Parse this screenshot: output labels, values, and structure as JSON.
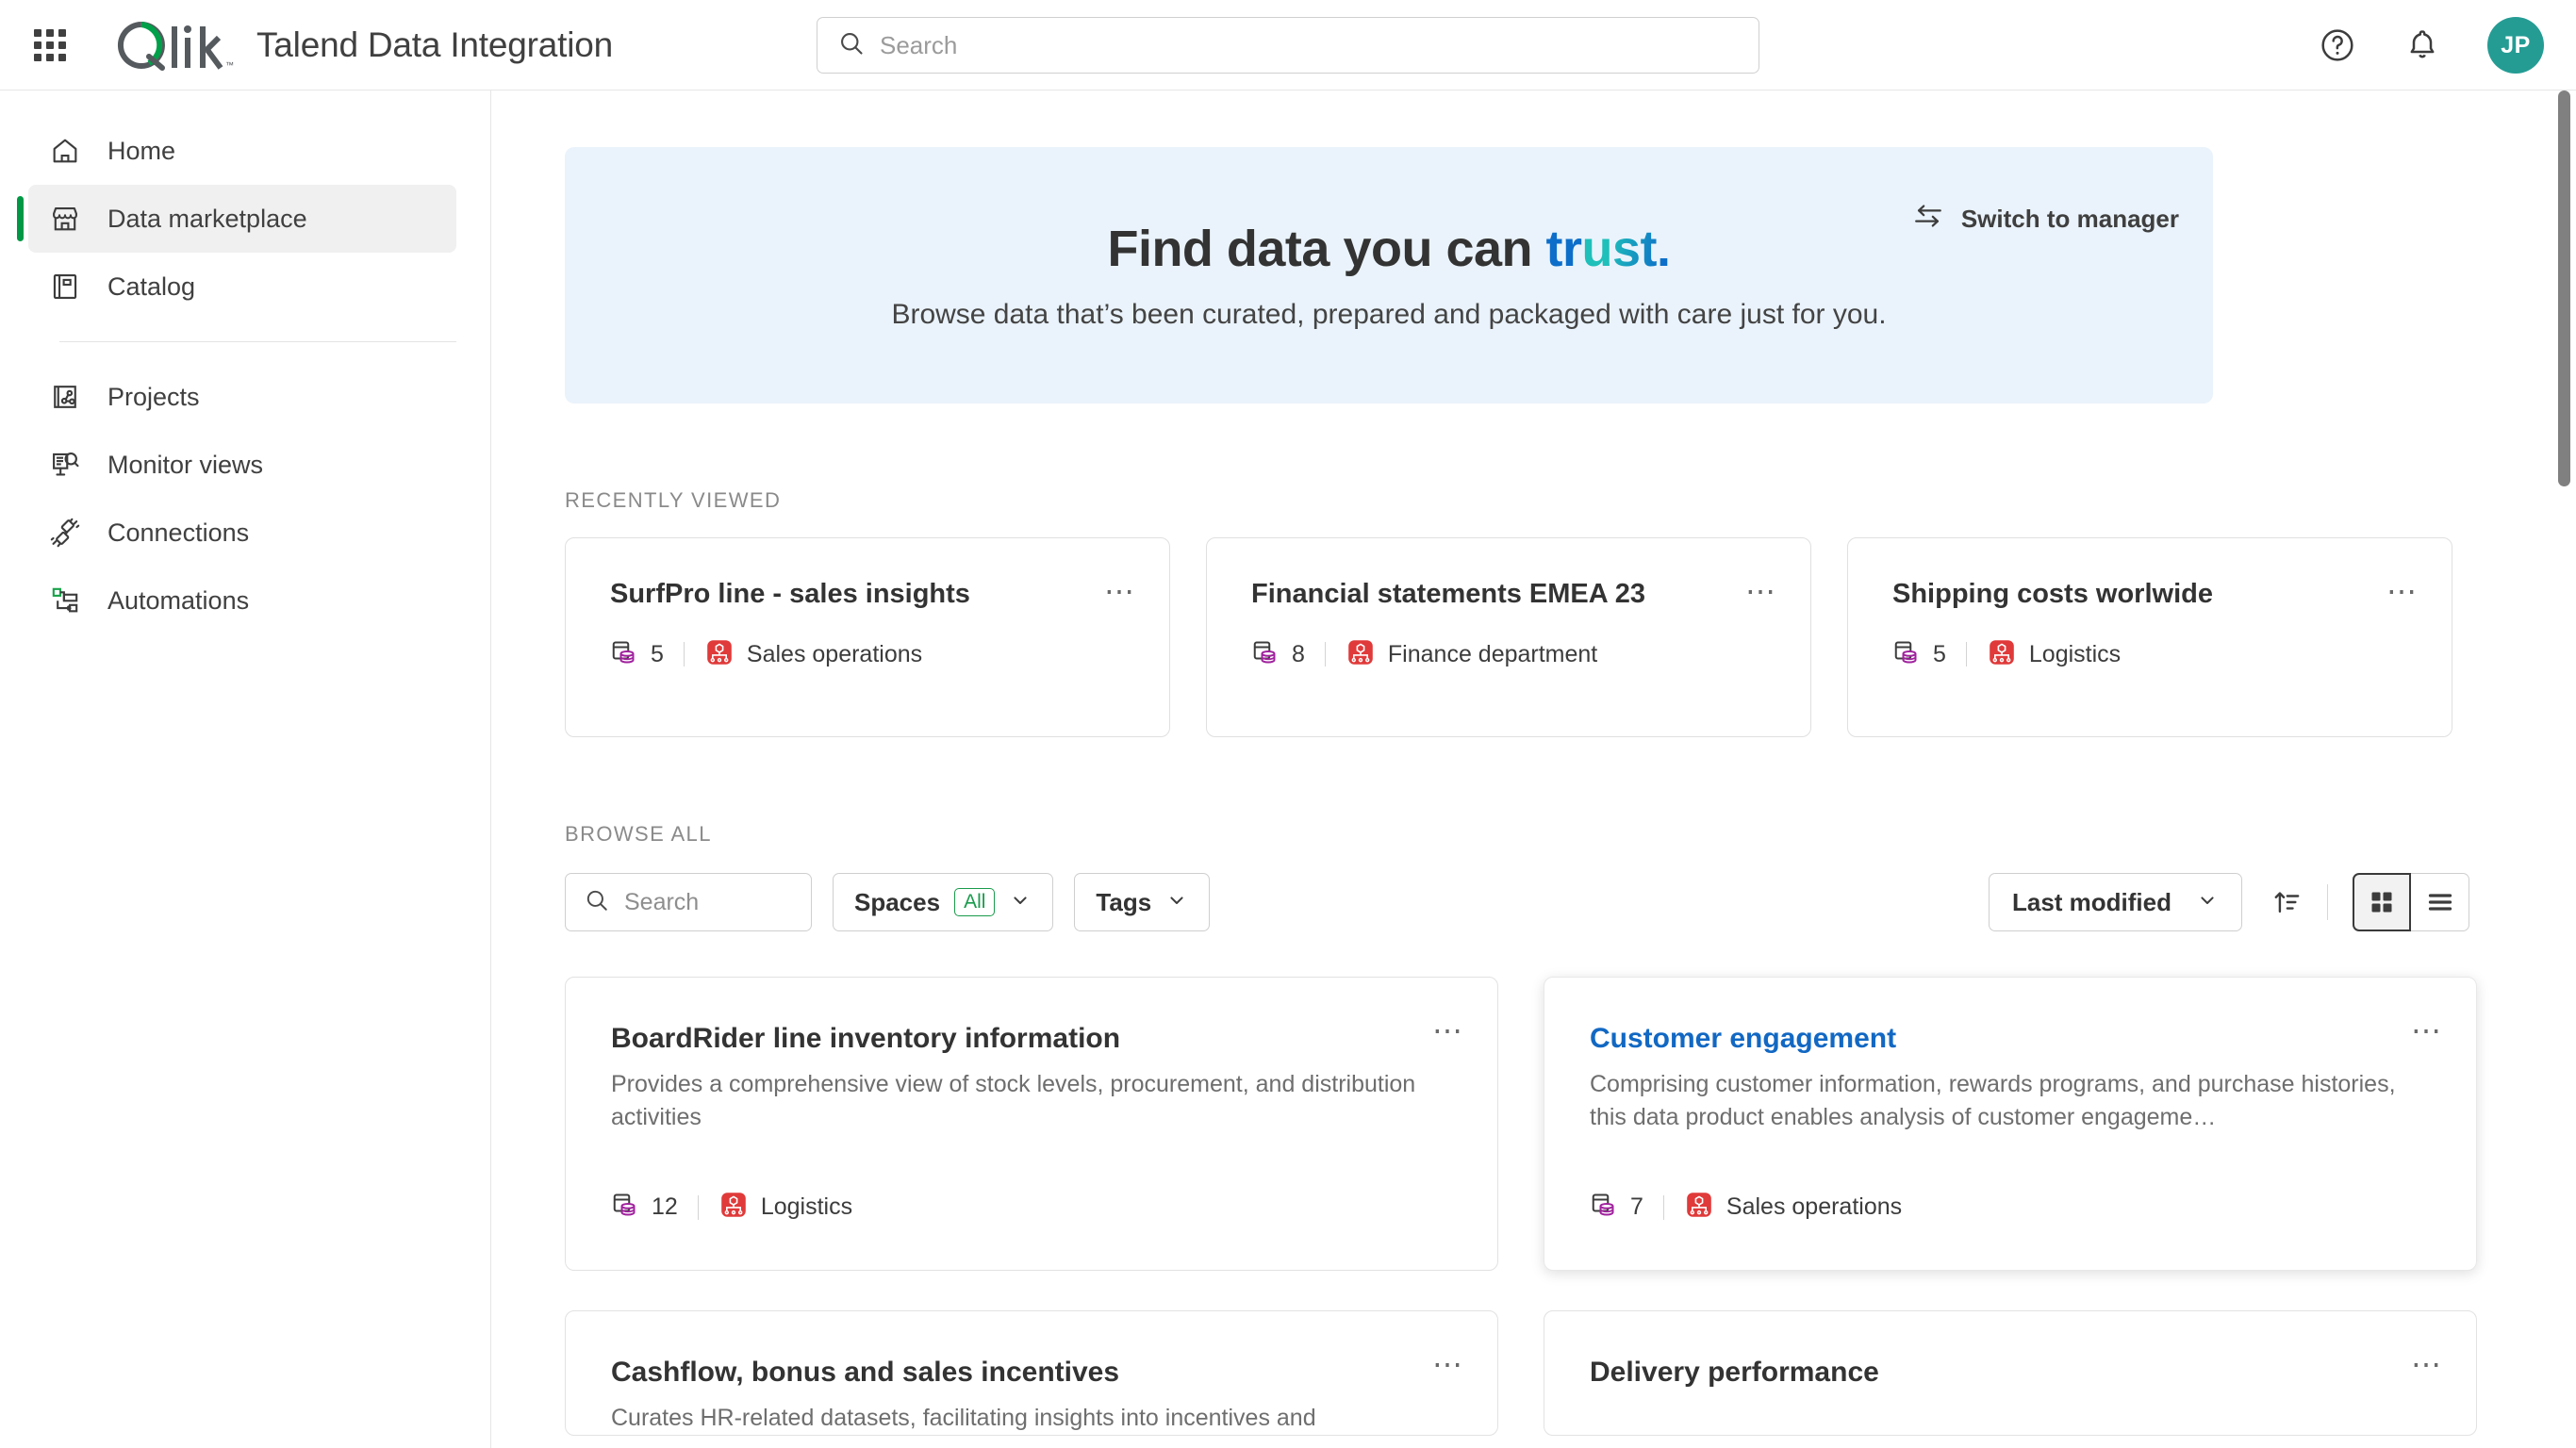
{
  "topbar": {
    "app_launcher_icon": "grid-apps-icon",
    "logo_text": "Qlik",
    "product_title": "Talend Data Integration",
    "search": {
      "placeholder": "Search",
      "value": "",
      "icon": "search-icon"
    },
    "help_icon": "help-circle-icon",
    "notifications_icon": "bell-icon",
    "avatar_initials": "JP",
    "avatar_color": "#249c94"
  },
  "sidebar": {
    "items": [
      {
        "label": "Home",
        "icon": "home-icon",
        "active": false
      },
      {
        "label": "Data marketplace",
        "icon": "marketplace-icon",
        "active": true
      },
      {
        "label": "Catalog",
        "icon": "catalog-icon",
        "active": false
      },
      {
        "label": "Projects",
        "icon": "projects-icon",
        "active": false
      },
      {
        "label": "Monitor views",
        "icon": "monitor-views-icon",
        "active": false
      },
      {
        "label": "Connections",
        "icon": "connections-icon",
        "active": false
      },
      {
        "label": "Automations",
        "icon": "automations-icon",
        "active": false
      }
    ],
    "active_accent_color": "#009845"
  },
  "hero": {
    "title_plain": "Find data you can ",
    "title_accent_1": "tr",
    "title_accent_2": "u",
    "title_accent_3": "st.",
    "subtitle": "Browse data that’s been curated, prepared and packaged with care just for you.",
    "switch_button_label": "Switch to manager",
    "switch_button_icon": "switch-arrows-icon",
    "background_color": "#eaf3fb",
    "accent_blue": "#0d6ec9",
    "accent_teal": "#1fbfba"
  },
  "recently_viewed": {
    "label": "RECENTLY VIEWED",
    "cards": [
      {
        "title": "SurfPro line - sales insights",
        "dataset_count": "5",
        "space": "Sales operations",
        "menu_icon": "kebab-menu-icon"
      },
      {
        "title": "Financial statements EMEA 23",
        "dataset_count": "8",
        "space": "Finance department",
        "menu_icon": "kebab-menu-icon"
      },
      {
        "title": "Shipping costs worlwide",
        "dataset_count": "5",
        "space": "Logistics",
        "menu_icon": "kebab-menu-icon"
      }
    ]
  },
  "browse_all": {
    "label": "BROWSE ALL",
    "search": {
      "placeholder": "Search",
      "value": "",
      "icon": "search-icon"
    },
    "spaces_filter": {
      "label": "Spaces",
      "badge": "All",
      "icon": "chevron-down-icon"
    },
    "tags_filter": {
      "label": "Tags",
      "icon": "chevron-down-icon"
    },
    "sort": {
      "value": "Last modified",
      "icon": "chevron-down-icon"
    },
    "sort_direction_icon": "sort-ascending-icon",
    "view_grid_icon": "grid-view-icon",
    "view_list_icon": "list-view-icon",
    "view_selected": "grid",
    "badge_green": "#1a9b4c"
  },
  "products": [
    {
      "title": "BoardRider line inventory information",
      "description": "Provides a comprehensive view of stock levels, procurement, and distribution activities",
      "dataset_count": "12",
      "space": "Logistics",
      "highlighted": false,
      "menu_icon": "kebab-menu-icon"
    },
    {
      "title": "Customer engagement",
      "description": "Comprising customer information, rewards programs, and purchase histories, this data product enables analysis of customer engageme…",
      "dataset_count": "7",
      "space": "Sales operations",
      "highlighted": true,
      "menu_icon": "kebab-menu-icon"
    },
    {
      "title": "Cashflow, bonus and sales incentives",
      "description": "Curates HR-related datasets, facilitating insights into incentives and",
      "dataset_count": "",
      "space": "",
      "highlighted": false,
      "menu_icon": "kebab-menu-icon"
    },
    {
      "title": "Delivery performance",
      "description": "",
      "dataset_count": "",
      "space": "",
      "highlighted": false,
      "menu_icon": "kebab-menu-icon"
    }
  ],
  "icons": {
    "dataset_icon": "dataset-database-icon",
    "space_icon": "shared-space-icon",
    "space_badge_color": "#e03a3a",
    "dataset_db_color": "#a0229e"
  }
}
